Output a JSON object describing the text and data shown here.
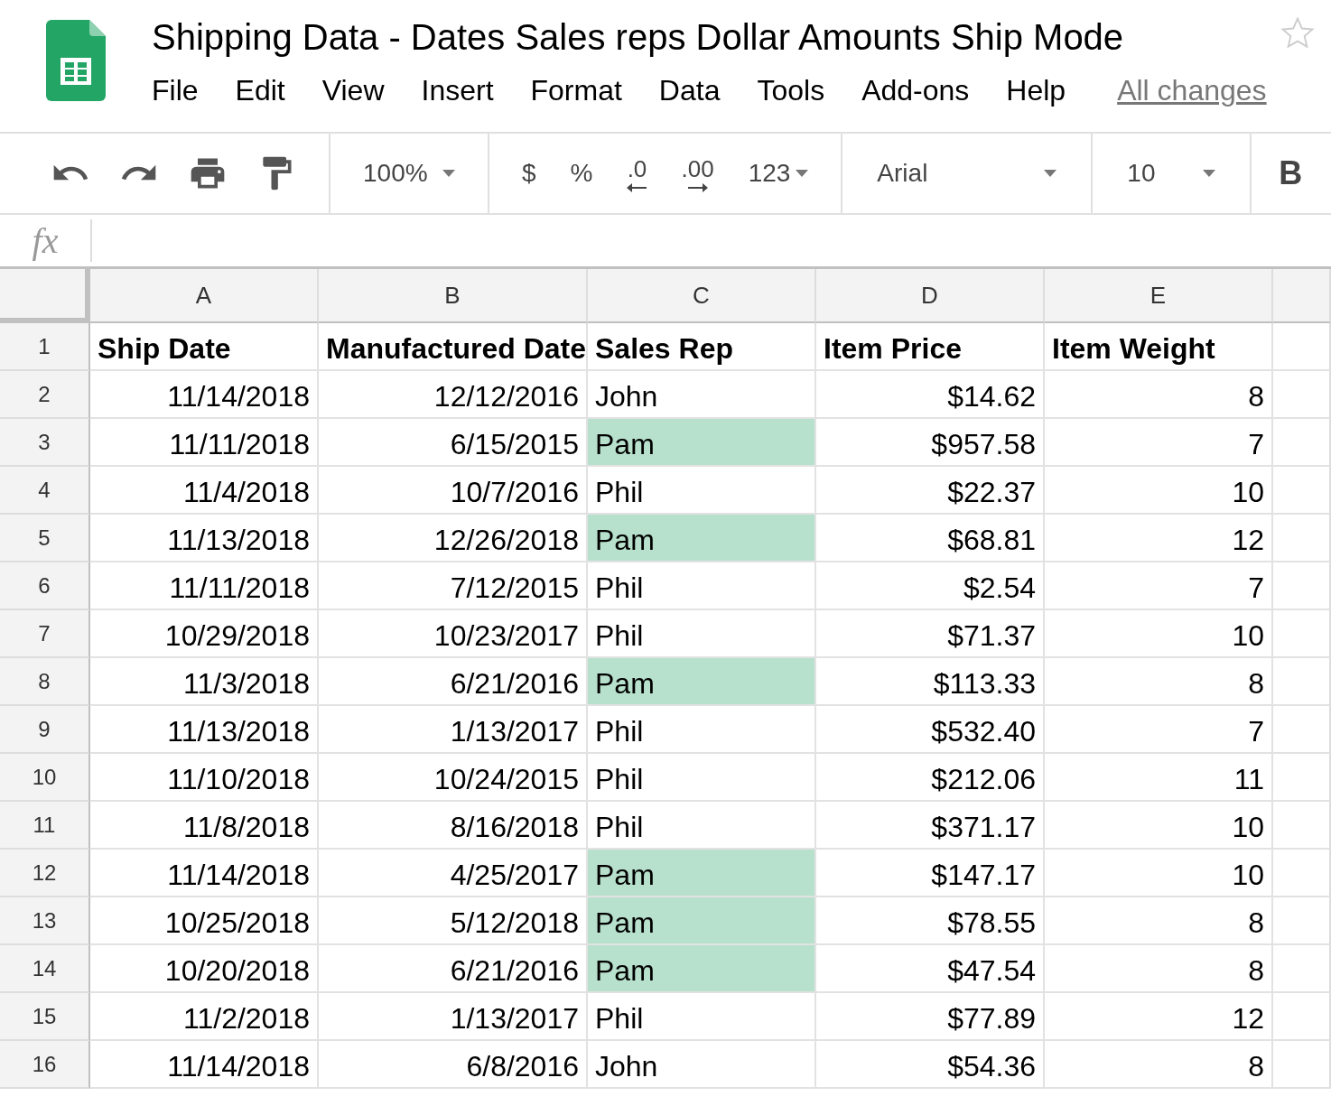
{
  "document": {
    "title": "Shipping Data - Dates Sales reps Dollar Amounts Ship Mode",
    "starred": false
  },
  "menu": [
    "File",
    "Edit",
    "View",
    "Insert",
    "Format",
    "Data",
    "Tools",
    "Add-ons",
    "Help"
  ],
  "save_status": "All changes",
  "toolbar": {
    "zoom": "100%",
    "currency": "$",
    "percent": "%",
    "decrease_decimals": ".0",
    "increase_decimals": ".00",
    "more_formats": "123",
    "font": "Arial",
    "font_size": "10",
    "bold": "B"
  },
  "formula_bar": {
    "label": "fx"
  },
  "columns": [
    "A",
    "B",
    "C",
    "D",
    "E"
  ],
  "header_row": {
    "number": "1",
    "cells": [
      "Ship Date",
      "Manufactured Date",
      "Sales Rep",
      "Item Price",
      "Item Weight"
    ]
  },
  "rows": [
    {
      "number": "2",
      "cells": [
        "11/14/2018",
        "12/12/2016",
        "John",
        "$14.62",
        "8"
      ],
      "highlighted": false
    },
    {
      "number": "3",
      "cells": [
        "11/11/2018",
        "6/15/2015",
        "Pam",
        "$957.58",
        "7"
      ],
      "highlighted": true
    },
    {
      "number": "4",
      "cells": [
        "11/4/2018",
        "10/7/2016",
        "Phil",
        "$22.37",
        "10"
      ],
      "highlighted": false
    },
    {
      "number": "5",
      "cells": [
        "11/13/2018",
        "12/26/2018",
        "Pam",
        "$68.81",
        "12"
      ],
      "highlighted": true
    },
    {
      "number": "6",
      "cells": [
        "11/11/2018",
        "7/12/2015",
        "Phil",
        "$2.54",
        "7"
      ],
      "highlighted": false
    },
    {
      "number": "7",
      "cells": [
        "10/29/2018",
        "10/23/2017",
        "Phil",
        "$71.37",
        "10"
      ],
      "highlighted": false
    },
    {
      "number": "8",
      "cells": [
        "11/3/2018",
        "6/21/2016",
        "Pam",
        "$113.33",
        "8"
      ],
      "highlighted": true
    },
    {
      "number": "9",
      "cells": [
        "11/13/2018",
        "1/13/2017",
        "Phil",
        "$532.40",
        "7"
      ],
      "highlighted": false
    },
    {
      "number": "10",
      "cells": [
        "11/10/2018",
        "10/24/2015",
        "Phil",
        "$212.06",
        "11"
      ],
      "highlighted": false
    },
    {
      "number": "11",
      "cells": [
        "11/8/2018",
        "8/16/2018",
        "Phil",
        "$371.17",
        "10"
      ],
      "highlighted": false
    },
    {
      "number": "12",
      "cells": [
        "11/14/2018",
        "4/25/2017",
        "Pam",
        "$147.17",
        "10"
      ],
      "highlighted": true
    },
    {
      "number": "13",
      "cells": [
        "10/25/2018",
        "5/12/2018",
        "Pam",
        "$78.55",
        "8"
      ],
      "highlighted": true
    },
    {
      "number": "14",
      "cells": [
        "10/20/2018",
        "6/21/2016",
        "Pam",
        "$47.54",
        "8"
      ],
      "highlighted": true
    },
    {
      "number": "15",
      "cells": [
        "11/2/2018",
        "1/13/2017",
        "Phil",
        "$77.89",
        "12"
      ],
      "highlighted": false
    },
    {
      "number": "16",
      "cells": [
        "11/14/2018",
        "6/8/2016",
        "John",
        "$54.36",
        "8"
      ],
      "highlighted": false
    }
  ]
}
